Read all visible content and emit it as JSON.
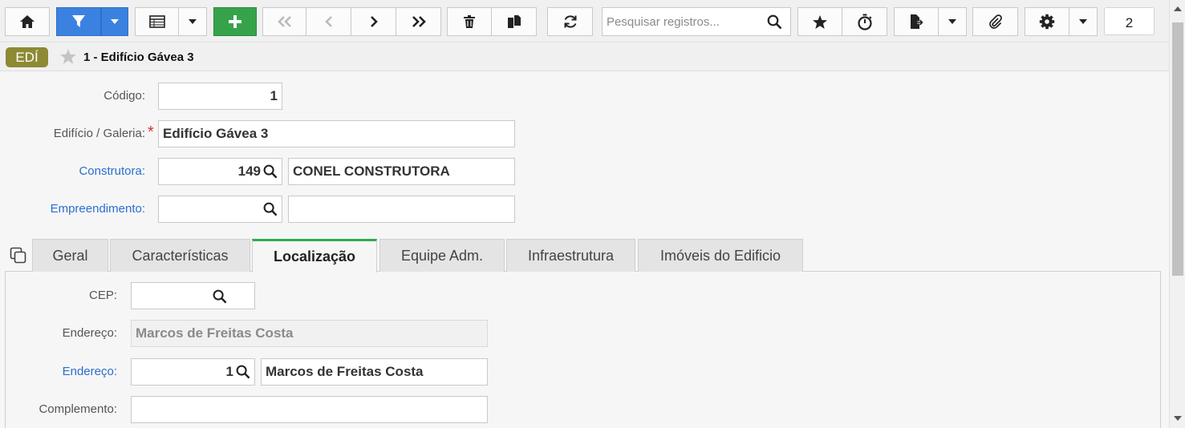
{
  "toolbar": {
    "search_placeholder": "Pesquisar registros...",
    "page_number": "2"
  },
  "record": {
    "badge": "EDÍ",
    "title": "1 - Edifício Gávea 3"
  },
  "form": {
    "codigo": {
      "label": "Código:",
      "value": "1"
    },
    "edificio": {
      "label": "Edifício / Galeria:",
      "required_mark": "*",
      "value": "Edifício Gávea 3"
    },
    "construtora": {
      "label": "Construtora:",
      "code": "149",
      "name": "CONEL CONSTRUTORA"
    },
    "empreendimento": {
      "label": "Empreendimento:",
      "code": "",
      "name": ""
    }
  },
  "tabs": [
    {
      "label": "Geral"
    },
    {
      "label": "Características"
    },
    {
      "label": "Localização"
    },
    {
      "label": "Equipe Adm."
    },
    {
      "label": "Infraestrutura"
    },
    {
      "label": "Imóveis do Edificio"
    }
  ],
  "active_tab": "Localização",
  "localizacao": {
    "cep": {
      "label": "CEP:",
      "value": ""
    },
    "endereco_readonly": {
      "label": "Endereço:",
      "value": "Marcos de Freitas Costa"
    },
    "endereco": {
      "label": "Endereço:",
      "code": "1",
      "name": "Marcos de Freitas Costa"
    },
    "complemento": {
      "label": "Complemento:",
      "value": ""
    }
  },
  "colors": {
    "accent_blue": "#3b82e0",
    "add_green": "#36a34b",
    "badge_olive": "#8d8a35",
    "link_blue": "#2a6ed0",
    "active_tab_green": "#2eaa4e"
  }
}
